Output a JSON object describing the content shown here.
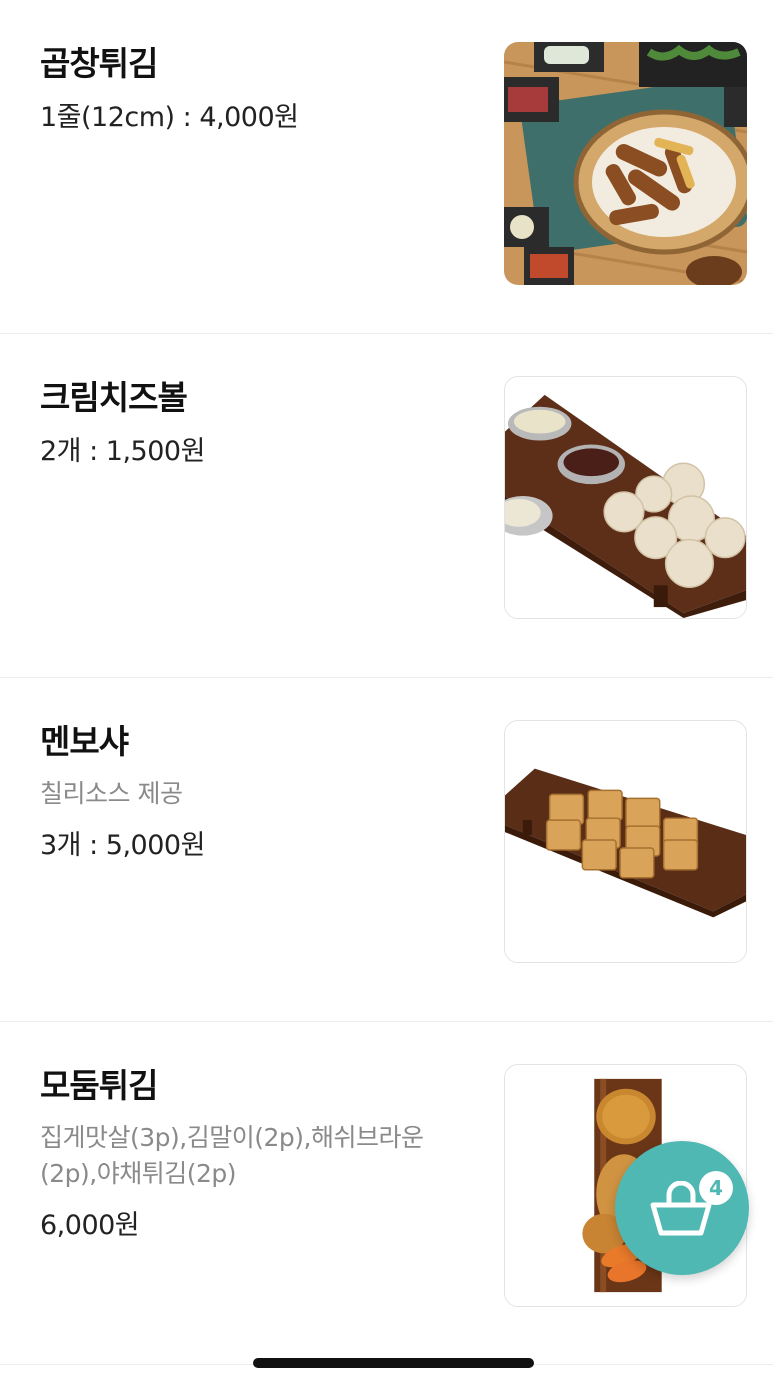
{
  "menu": {
    "items": [
      {
        "name": "곱창튀김",
        "description": "",
        "price": "1줄(12cm) : 4,000원",
        "image_icon": "fried-gopchang-photo"
      },
      {
        "name": "크림치즈볼",
        "description": "",
        "price": "2개 : 1,500원",
        "image_icon": "cream-cheese-ball-photo"
      },
      {
        "name": "멘보샤",
        "description": "칠리소스 제공",
        "price": "3개 : 5,000원",
        "image_icon": "menbosha-photo"
      },
      {
        "name": "모둠튀김",
        "description": "집게맛살(3p),김말이(2p),해쉬브라운(2p),야채튀김(2p)",
        "price": "6,000원",
        "image_icon": "assorted-fried-photo"
      }
    ]
  },
  "cart": {
    "count": "4",
    "icon": "shopping-basket-icon",
    "accent_color": "#4fb8b3"
  }
}
